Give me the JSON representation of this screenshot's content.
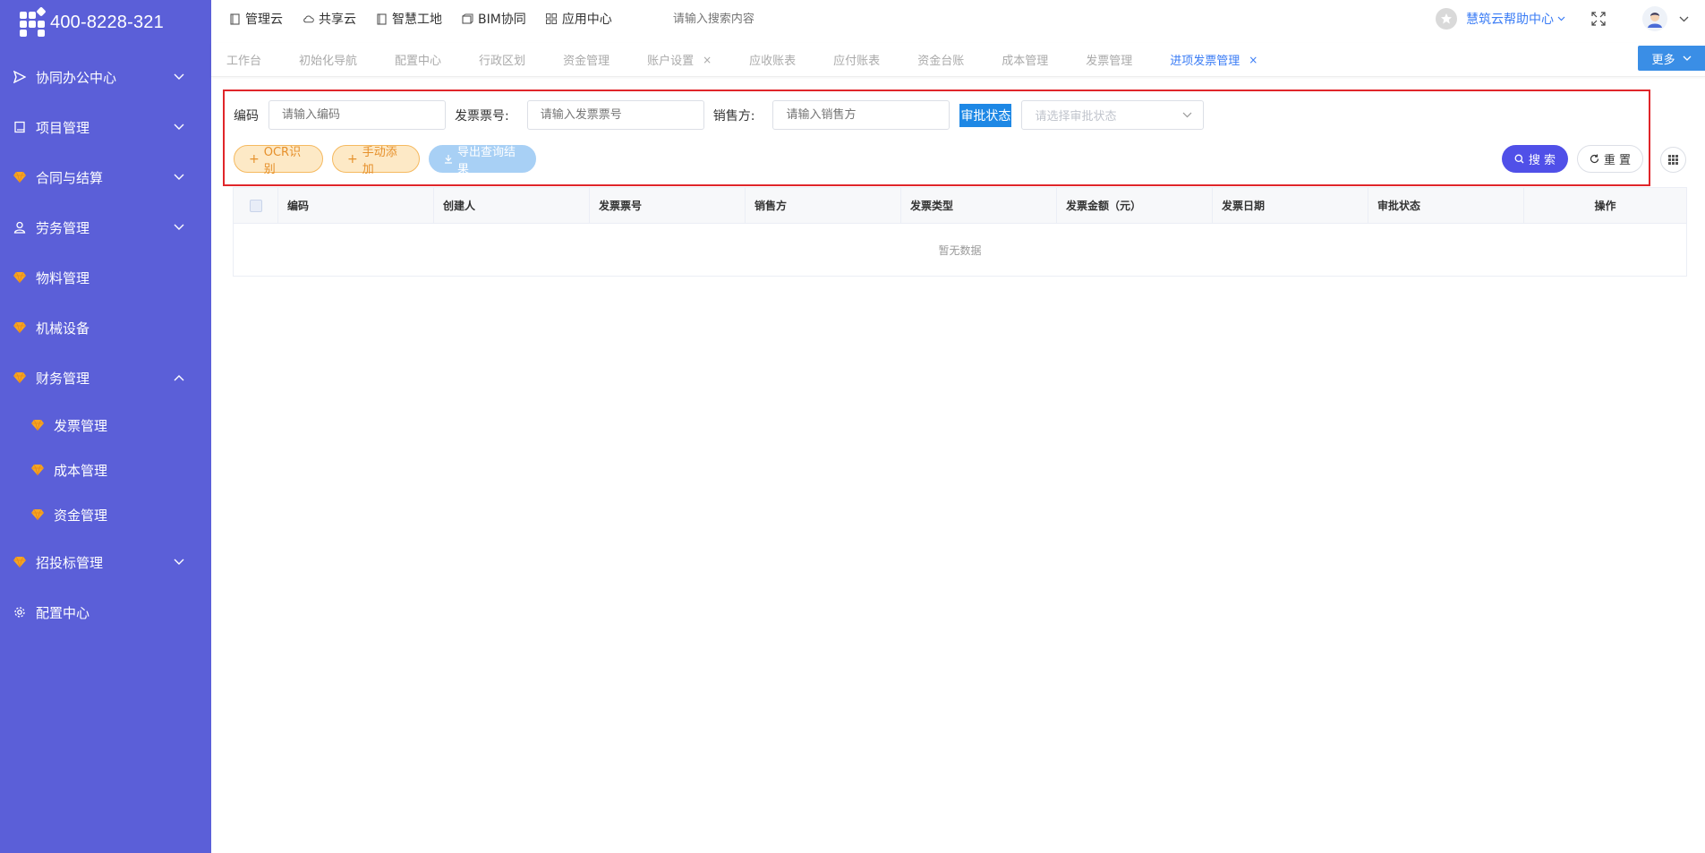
{
  "logo": {
    "phone": "400-8228-321"
  },
  "sidebar": {
    "items": [
      {
        "label": "协同办公中心",
        "icon": "send-icon",
        "expandable": true,
        "expanded": false
      },
      {
        "label": "项目管理",
        "icon": "book-icon",
        "expandable": true,
        "expanded": false
      },
      {
        "label": "合同与结算",
        "icon": "diamond-icon",
        "expandable": true,
        "expanded": false
      },
      {
        "label": "劳务管理",
        "icon": "worker-icon",
        "expandable": true,
        "expanded": false
      },
      {
        "label": "物料管理",
        "icon": "diamond-icon",
        "expandable": false
      },
      {
        "label": "机械设备",
        "icon": "diamond-icon",
        "expandable": false
      },
      {
        "label": "财务管理",
        "icon": "diamond-icon",
        "expandable": true,
        "expanded": true
      },
      {
        "label": "招投标管理",
        "icon": "diamond-icon",
        "expandable": true,
        "expanded": false
      },
      {
        "label": "配置中心",
        "icon": "gear-icon",
        "expandable": false
      }
    ],
    "finance_sub": [
      {
        "label": "发票管理"
      },
      {
        "label": "成本管理"
      },
      {
        "label": "资金管理"
      }
    ]
  },
  "topnav": {
    "items": [
      {
        "label": "管理云",
        "icon": "doc-icon"
      },
      {
        "label": "共享云",
        "icon": "cloud-icon"
      },
      {
        "label": "智慧工地",
        "icon": "doc-icon"
      },
      {
        "label": "BIM协同",
        "icon": "cube-icon"
      },
      {
        "label": "应用中心",
        "icon": "apps-icon"
      }
    ],
    "search_placeholder": "请输入搜索内容",
    "help_label": "慧筑云帮助中心"
  },
  "tabs": {
    "items": [
      {
        "label": "工作台",
        "closable": false,
        "active": false
      },
      {
        "label": "初始化导航",
        "closable": false,
        "active": false
      },
      {
        "label": "配置中心",
        "closable": false,
        "active": false
      },
      {
        "label": "行政区划",
        "closable": false,
        "active": false
      },
      {
        "label": "资金管理",
        "closable": false,
        "active": false
      },
      {
        "label": "账户设置",
        "closable": true,
        "active": false
      },
      {
        "label": "应收账表",
        "closable": false,
        "active": false
      },
      {
        "label": "应付账表",
        "closable": false,
        "active": false
      },
      {
        "label": "资金台账",
        "closable": false,
        "active": false
      },
      {
        "label": "成本管理",
        "closable": false,
        "active": false
      },
      {
        "label": "发票管理",
        "closable": false,
        "active": false
      },
      {
        "label": "进项发票管理",
        "closable": true,
        "active": true
      }
    ],
    "more_label": "更多"
  },
  "filters": {
    "code_label": "编码",
    "code_placeholder": "请输入编码",
    "invoice_no_label": "发票票号:",
    "invoice_no_placeholder": "请输入发票票号",
    "seller_label": "销售方:",
    "seller_placeholder": "请输入销售方",
    "status_label": "审批状态",
    "status_placeholder": "请选择审批状态"
  },
  "actions": {
    "ocr_label": "OCR识别",
    "manual_add_label": "手动添加",
    "export_label": "导出查询结果",
    "search_label": "搜 索",
    "reset_label": "重 置"
  },
  "table": {
    "columns": [
      "编码",
      "创建人",
      "发票票号",
      "销售方",
      "发票类型",
      "发票金额（元）",
      "发票日期",
      "审批状态",
      "操作"
    ],
    "empty_text": "暂无数据"
  },
  "colors": {
    "sidebar_bg": "#5b5fd8",
    "accent_blue": "#3a7cf5",
    "search_btn": "#5050e8",
    "highlight_border": "#e0262a",
    "diamond": "#f5a623"
  }
}
